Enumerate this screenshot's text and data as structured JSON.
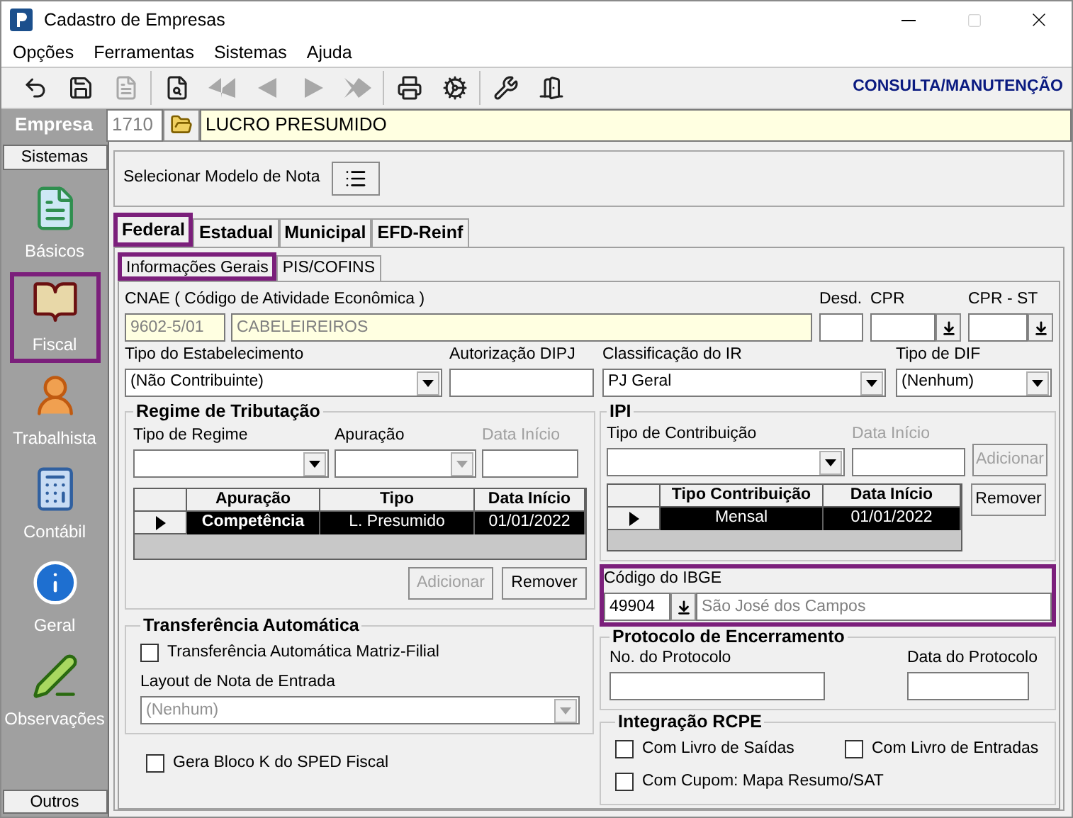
{
  "window": {
    "title": "Cadastro de Empresas"
  },
  "menu": [
    "Opções",
    "Ferramentas",
    "Sistemas",
    "Ajuda"
  ],
  "toolbar": {
    "groups": [
      [
        {
          "kind": "undo",
          "disabled": false
        },
        {
          "kind": "save",
          "disabled": false
        },
        {
          "kind": "document",
          "disabled": true
        }
      ],
      [
        {
          "kind": "preview",
          "disabled": false
        },
        {
          "kind": "first",
          "disabled": true
        },
        {
          "kind": "previous",
          "disabled": true
        },
        {
          "kind": "next",
          "disabled": true
        },
        {
          "kind": "last",
          "disabled": true
        }
      ],
      [
        {
          "kind": "print",
          "disabled": false
        },
        {
          "kind": "settings",
          "disabled": false
        }
      ],
      [
        {
          "kind": "tools",
          "disabled": false
        },
        {
          "kind": "exit",
          "disabled": false
        }
      ]
    ],
    "mode": "CONSULTA/MANUTENÇÃO"
  },
  "empresa": {
    "label": "Empresa",
    "code": "1710",
    "name": "LUCRO PRESUMIDO"
  },
  "sidebar": {
    "header": "Sistemas",
    "footer": "Outros",
    "items": [
      {
        "label": "Básicos",
        "kind": "document",
        "highlighted": false
      },
      {
        "label": "Fiscal",
        "kind": "book",
        "highlighted": true
      },
      {
        "label": "Trabalhista",
        "kind": "person",
        "highlighted": false
      },
      {
        "label": "Contábil",
        "kind": "calculator",
        "highlighted": false
      },
      {
        "label": "Geral",
        "kind": "info",
        "highlighted": false
      },
      {
        "label": "Observações",
        "kind": "pencil",
        "highlighted": false
      }
    ]
  },
  "modelo_nota": {
    "label": "Selecionar Modelo de Nota"
  },
  "tabs": [
    {
      "label": "Federal",
      "selected": true,
      "highlighted": true
    },
    {
      "label": "Estadual",
      "selected": false,
      "highlighted": false
    },
    {
      "label": "Municipal",
      "selected": false,
      "highlighted": false
    },
    {
      "label": "EFD-Reinf",
      "selected": false,
      "highlighted": false
    }
  ],
  "subtabs": [
    {
      "label": "Informações Gerais",
      "selected": true,
      "highlighted": true
    },
    {
      "label": "PIS/COFINS",
      "selected": false,
      "highlighted": false
    }
  ],
  "cnae": {
    "label": "CNAE ( Código de  Atividade Econômica )",
    "code": "9602-5/01",
    "description": "CABELEIREIROS"
  },
  "desd": {
    "label": "Desd."
  },
  "cpr": {
    "label": "CPR"
  },
  "cpr_st": {
    "label": "CPR - ST"
  },
  "tipo_estabelecimento": {
    "label": "Tipo do Estabelecimento",
    "value": "(Não Contribuinte)"
  },
  "autorizacao_dipj": {
    "label": "Autorização DIPJ"
  },
  "classificacao_ir": {
    "label": "Classificação do IR",
    "value": "PJ Geral"
  },
  "tipo_dif": {
    "label": "Tipo de DIF",
    "value": "(Nenhum)"
  },
  "regime": {
    "title": "Regime de Tributação",
    "tipo_regime": {
      "label": "Tipo de Regime"
    },
    "apuracao": {
      "label": "Apuração",
      "disabled": true
    },
    "data_inicio": {
      "label": "Data Início",
      "disabled": true
    },
    "table": {
      "columns": [
        "Apuração",
        "Tipo",
        "Data Início"
      ],
      "rows": [
        {
          "cells": [
            "Competência",
            "L. Presumido",
            "01/01/2022"
          ],
          "selected": true
        }
      ]
    },
    "buttons": [
      {
        "label": "Adicionar",
        "disabled": true
      },
      {
        "label": "Remover",
        "disabled": false
      }
    ]
  },
  "transferencia": {
    "title": "Transferência Automática",
    "checkbox": {
      "label": "Transferência Automática Matriz-Filial",
      "checked": false
    },
    "layout": {
      "label": "Layout de Nota de Entrada",
      "value": "(Nenhum)",
      "disabled": true
    }
  },
  "bloco_k": {
    "label": "Gera Bloco K do SPED Fiscal",
    "checked": false
  },
  "ipi": {
    "title": "IPI",
    "tipo_contribuicao": {
      "label": "Tipo de Contribuição"
    },
    "data_inicio": {
      "label": "Data Início",
      "disabled": true
    },
    "buttons": [
      {
        "label": "Adicionar",
        "disabled": true
      },
      {
        "label": "Remover",
        "disabled": false
      }
    ],
    "table": {
      "columns": [
        "Tipo Contribuição",
        "Data Início"
      ],
      "rows": [
        {
          "cells": [
            "Mensal",
            "01/01/2022"
          ],
          "selected": true
        }
      ]
    }
  },
  "ibge": {
    "label": "Código do IBGE",
    "code": "49904",
    "city": "São José dos Campos",
    "highlighted": true
  },
  "protocolo": {
    "title": "Protocolo de Encerramento",
    "numero": {
      "label": "No. do Protocolo"
    },
    "data": {
      "label": "Data do Protocolo"
    }
  },
  "rcpe": {
    "title": "Integração RCPE",
    "checkboxes": [
      {
        "label": "Com Livro de Saídas",
        "checked": false
      },
      {
        "label": "Com Livro de Entradas",
        "checked": false
      },
      {
        "label": "Com Cupom: Mapa Resumo/SAT",
        "checked": false
      }
    ]
  }
}
